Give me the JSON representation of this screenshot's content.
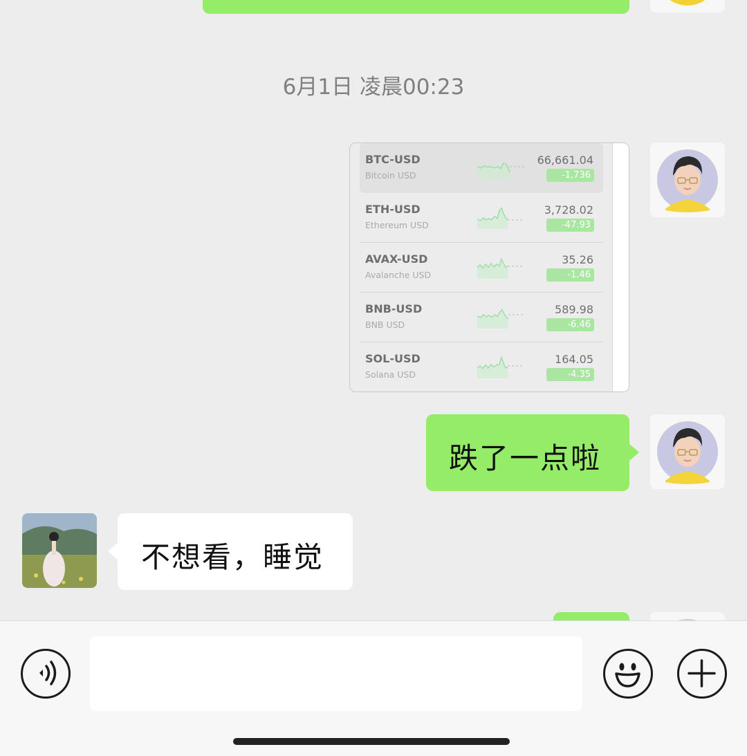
{
  "timestamp": "6月1日 凌晨00:23",
  "stocks": [
    {
      "symbol": "BTC-USD",
      "name": "Bitcoin USD",
      "price": "66,661.04",
      "change": "-1,736"
    },
    {
      "symbol": "ETH-USD",
      "name": "Ethereum USD",
      "price": "3,728.02",
      "change": "-47.93"
    },
    {
      "symbol": "AVAX-USD",
      "name": "Avalanche USD",
      "price": "35.26",
      "change": "-1.46"
    },
    {
      "symbol": "BNB-USD",
      "name": "BNB USD",
      "price": "589.98",
      "change": "-6.46"
    },
    {
      "symbol": "SOL-USD",
      "name": "Solana USD",
      "price": "164.05",
      "change": "-4.35"
    }
  ],
  "messages": {
    "self_text": "跌了一点啦",
    "peer_text": "不想看，睡觉"
  },
  "input": {
    "value": ""
  },
  "colors": {
    "self_bubble": "#95ec69",
    "peer_bubble": "#ffffff",
    "chat_bg": "#ededed",
    "change_badge": "#a8e6a1"
  },
  "icons": {
    "voice": "voice-icon",
    "emoji": "emoji-icon",
    "plus": "plus-icon"
  }
}
